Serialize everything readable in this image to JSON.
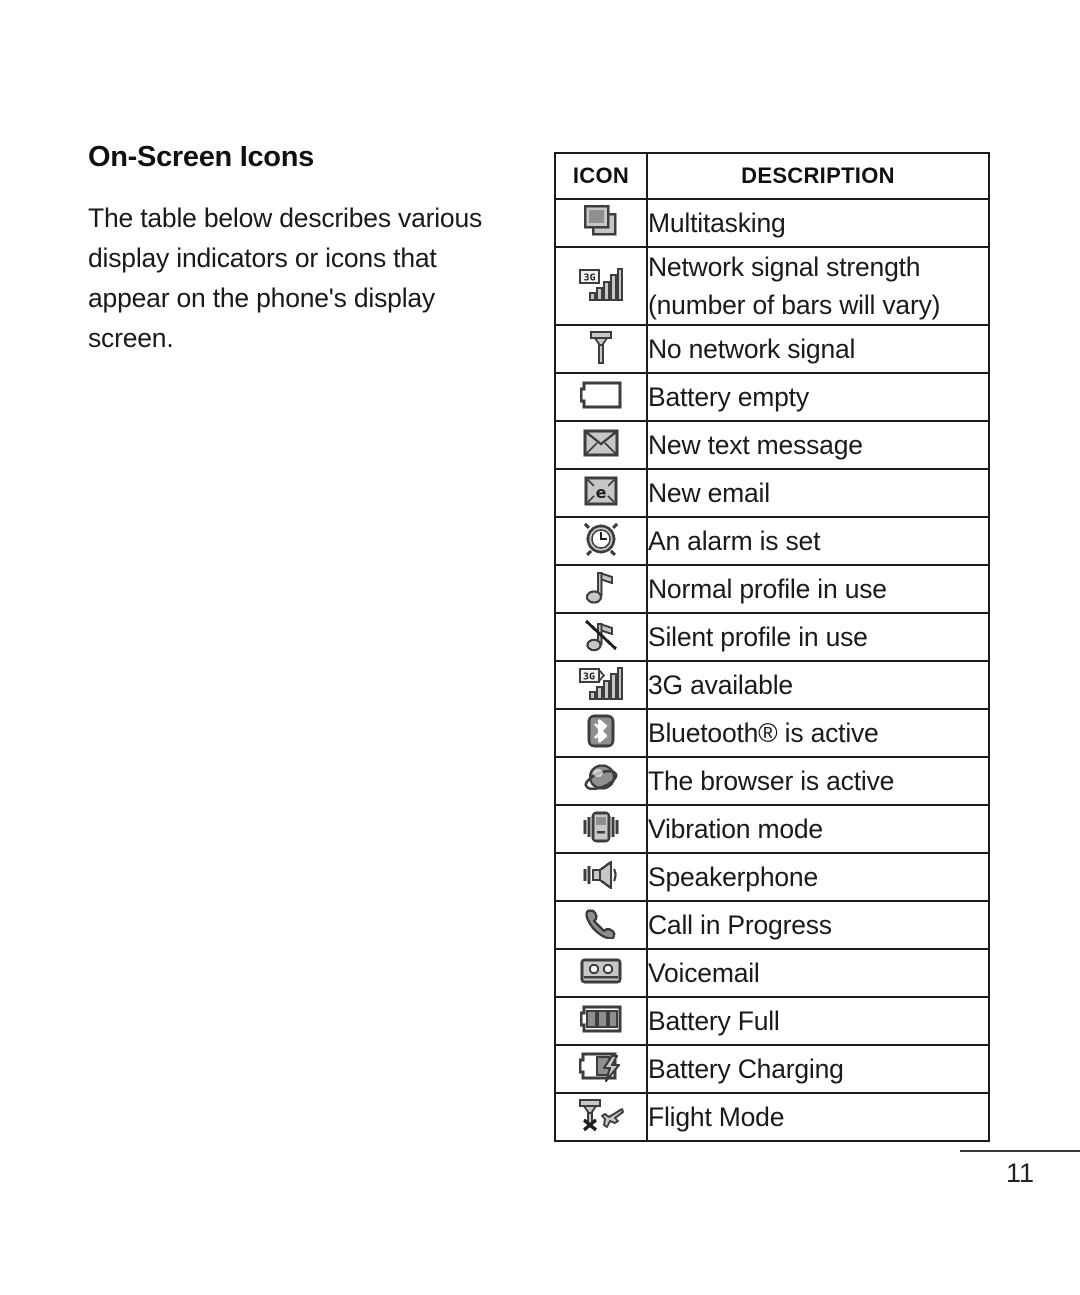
{
  "document": {
    "heading": "On-Screen Icons",
    "intro": "The table below describes various display indicators or icons that appear on the phone's display screen.",
    "page_number": "11"
  },
  "table": {
    "headers": {
      "icon": "ICON",
      "description": "DESCRIPTION"
    },
    "rows": [
      {
        "icon_name": "multitasking-icon",
        "description": "Multitasking"
      },
      {
        "icon_name": "network-signal-3g-icon",
        "description": "Network signal strength\n(number of bars will vary)"
      },
      {
        "icon_name": "no-network-signal-icon",
        "description": "No network signal"
      },
      {
        "icon_name": "battery-empty-icon",
        "description": "Battery empty"
      },
      {
        "icon_name": "new-text-message-icon",
        "description": "New text message"
      },
      {
        "icon_name": "new-email-icon",
        "description": "New email"
      },
      {
        "icon_name": "alarm-clock-icon",
        "description": "An alarm is set"
      },
      {
        "icon_name": "music-note-icon",
        "description": "Normal profile in use"
      },
      {
        "icon_name": "music-note-muted-icon",
        "description": "Silent profile in use"
      },
      {
        "icon_name": "3g-available-icon",
        "description": "3G available"
      },
      {
        "icon_name": "bluetooth-icon",
        "description": "Bluetooth® is active"
      },
      {
        "icon_name": "browser-globe-icon",
        "description": "The browser is active"
      },
      {
        "icon_name": "vibration-mode-icon",
        "description": "Vibration mode"
      },
      {
        "icon_name": "speakerphone-icon",
        "description": "Speakerphone"
      },
      {
        "icon_name": "call-in-progress-icon",
        "description": "Call in Progress"
      },
      {
        "icon_name": "voicemail-icon",
        "description": "Voicemail"
      },
      {
        "icon_name": "battery-full-icon",
        "description": "Battery Full"
      },
      {
        "icon_name": "battery-charging-icon",
        "description": "Battery Charging"
      },
      {
        "icon_name": "flight-mode-icon",
        "description": "Flight Mode"
      }
    ]
  },
  "colors": {
    "ink": "#1a1a1a",
    "rule": "#1c1c1c",
    "icon_dark": "#3a3a3a",
    "icon_light": "#c9c9c9",
    "page": "#ffffff"
  }
}
